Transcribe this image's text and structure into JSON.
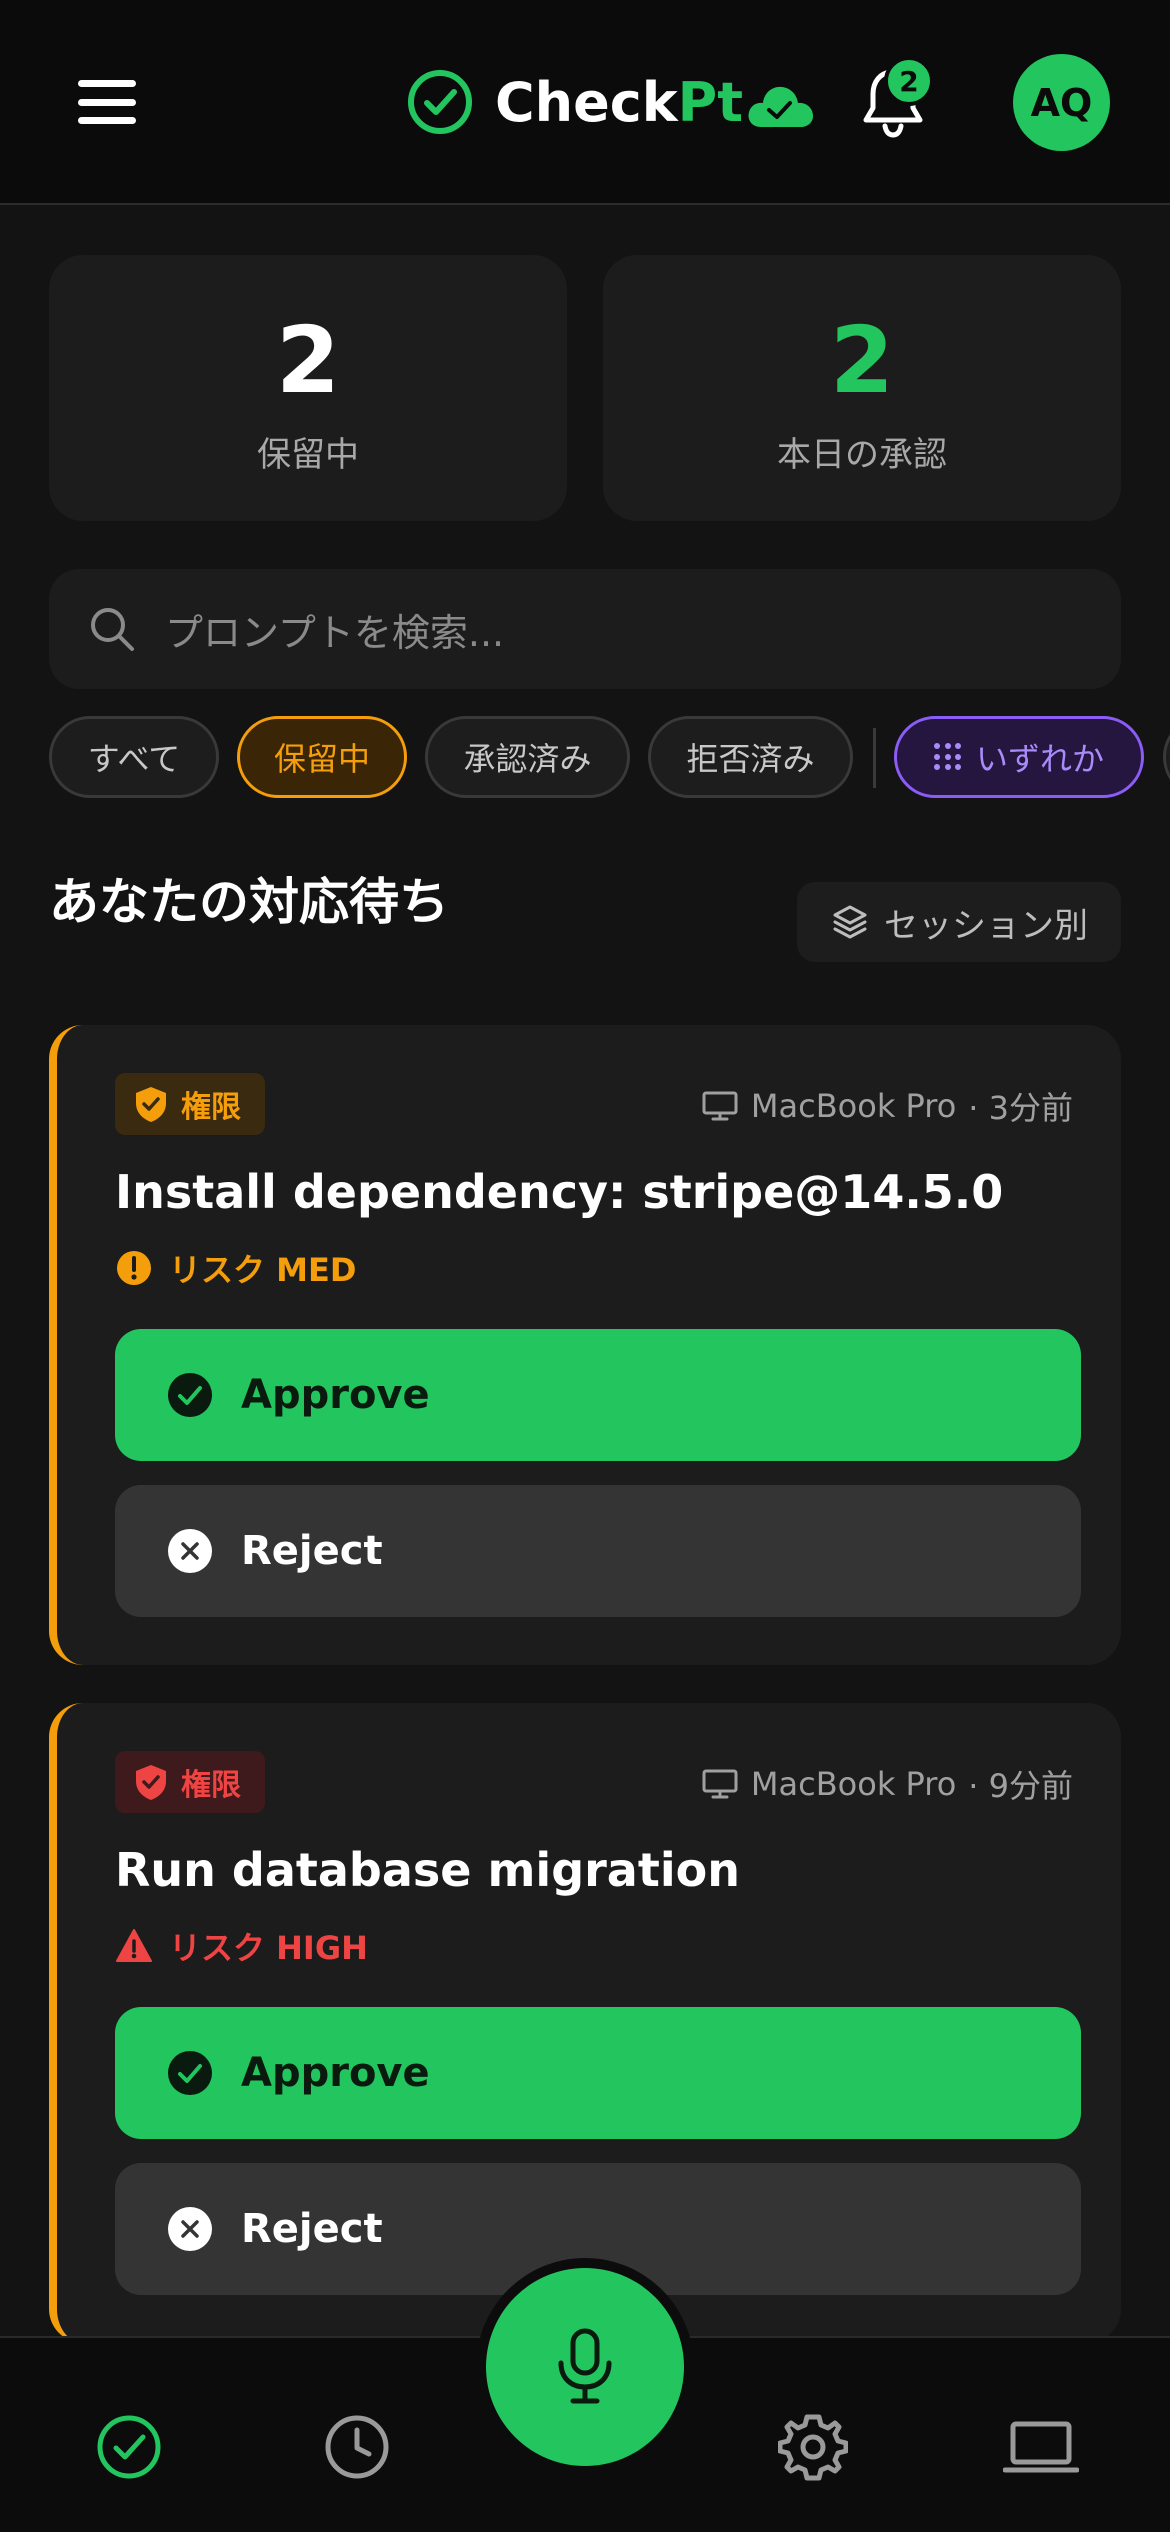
{
  "header": {
    "logo_part1": "Check",
    "logo_part2": "Pt",
    "notification_count": "2",
    "avatar_initials": "AQ",
    "brand_color": "#22c55e"
  },
  "stats": [
    {
      "value": "2",
      "label": "保留中"
    },
    {
      "value": "2",
      "label": "本日の承認"
    }
  ],
  "search": {
    "placeholder": "プロンプトを検索..."
  },
  "filters": {
    "all": "すべて",
    "pending": "保留中",
    "approved": "承認済み",
    "rejected": "拒否済み",
    "any": "いずれか"
  },
  "section": {
    "title": "あなたの対応待ち",
    "group_button": "セッション別"
  },
  "cards": [
    {
      "tag": "権限",
      "device": "MacBook Pro",
      "time": "· 3分前",
      "title": "Install dependency: stripe@14.5.0",
      "risk": "リスク MED",
      "approve_label": "Approve",
      "reject_label": "Reject"
    },
    {
      "tag": "権限",
      "device": "MacBook Pro",
      "time": "· 9分前",
      "title": "Run database migration",
      "risk": "リスク HIGH",
      "approve_label": "Approve",
      "reject_label": "Reject"
    }
  ],
  "bottom_nav": {
    "items": [
      "check-circle-icon",
      "clock-icon",
      "microphone-icon",
      "gear-icon",
      "laptop-icon"
    ]
  }
}
